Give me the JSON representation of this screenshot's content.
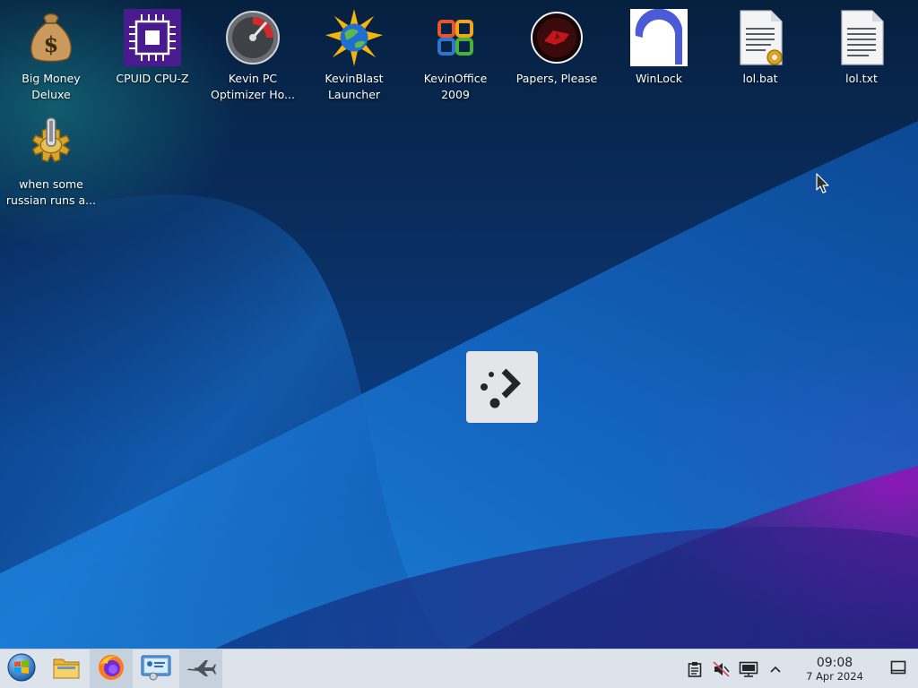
{
  "desktop": {
    "icons": [
      {
        "label": "Big Money\nDeluxe",
        "icon": "money-bag-icon"
      },
      {
        "label": "CPUID CPU-Z",
        "icon": "cpu-chip-icon"
      },
      {
        "label": "Kevin PC\nOptimizer Ho...",
        "icon": "speedometer-gauge-icon"
      },
      {
        "label": "KevinBlast\nLauncher",
        "icon": "globe-starburst-icon"
      },
      {
        "label": "KevinOffice\n2009",
        "icon": "office-logo-icon"
      },
      {
        "label": "Papers, Please",
        "icon": "papers-please-seal-icon"
      },
      {
        "label": "WinLock",
        "icon": "winlock-arc-icon"
      },
      {
        "label": "lol.bat",
        "icon": "batch-script-file-icon"
      },
      {
        "label": "lol.txt",
        "icon": "text-file-icon"
      },
      {
        "label": "when some\nrussian runs a...",
        "icon": "gear-script-icon"
      }
    ]
  },
  "busy_indicator": {
    "icon": "loading-spinner-icon"
  },
  "taskbar": {
    "buttons": [
      {
        "name": "start-menu-button",
        "icon": "windows-orb-icon"
      },
      {
        "name": "file-manager-button",
        "icon": "folder-icon"
      },
      {
        "name": "firefox-button",
        "icon": "firefox-icon"
      },
      {
        "name": "system-settings-button",
        "icon": "control-panel-icon"
      },
      {
        "name": "jet-app-button",
        "icon": "jet-plane-icon"
      }
    ],
    "tray": {
      "icons": [
        "clipboard-icon",
        "volume-muted-icon",
        "display-monitor-icon",
        "chevron-up-icon"
      ],
      "clock_time": "09:08",
      "clock_date": "7 Apr 2024",
      "show_desktop_icon": "show-desktop-icon"
    }
  },
  "colors": {
    "taskbar_bg": "#dde3ea",
    "wallpaper_blue": "#0a3e86",
    "wallpaper_purple": "#a014be"
  }
}
